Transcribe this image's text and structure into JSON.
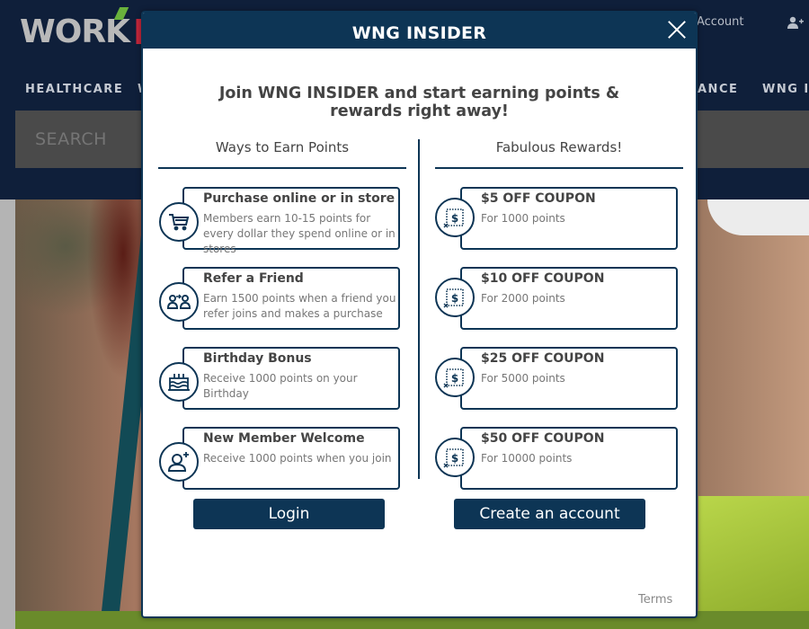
{
  "site": {
    "logo": {
      "work": "WORK",
      "n": "N"
    },
    "account_label": "Account",
    "nav": [
      {
        "label": "HEALTHCARE"
      },
      {
        "label": "W"
      },
      {
        "label": "ANCE"
      },
      {
        "label": "WNG IN"
      }
    ],
    "search": {
      "placeholder": "SEARCH"
    }
  },
  "modal": {
    "title": "WNG INSIDER",
    "headline_line1": "Join WNG INSIDER and start earning points &",
    "headline_line2": "rewards right away!",
    "earn": {
      "title": "Ways to Earn Points",
      "items": [
        {
          "icon": "shopping-cart-icon",
          "title": "Purchase online or in store",
          "desc": "Members earn 10-15 points for every dollar they spend online or in stores"
        },
        {
          "icon": "refer-friend-icon",
          "title": "Refer a Friend",
          "desc": "Earn 1500 points when a friend you refer joins and makes a purchase"
        },
        {
          "icon": "birthday-cake-icon",
          "title": "Birthday Bonus",
          "desc": "Receive 1000 points on your Birthday"
        },
        {
          "icon": "add-user-icon",
          "title": "New Member Welcome",
          "desc": "Receive 1000 points when you join"
        }
      ]
    },
    "rewards": {
      "title": "Fabulous Rewards!",
      "items": [
        {
          "icon": "coupon-icon",
          "title": "$5 OFF COUPON",
          "desc": "For 1000 points"
        },
        {
          "icon": "coupon-icon",
          "title": "$10 OFF COUPON",
          "desc": "For 2000 points"
        },
        {
          "icon": "coupon-icon",
          "title": "$25 OFF COUPON",
          "desc": "For 5000 points"
        },
        {
          "icon": "coupon-icon",
          "title": "$50 OFF COUPON",
          "desc": "For 10000 points"
        }
      ]
    },
    "login_label": "Login",
    "create_account_label": "Create an account",
    "terms_label": "Terms"
  },
  "colors": {
    "brand_navy": "#0d3555",
    "header_bg": "#0f1f3a",
    "logo_red": "#c3263a",
    "logo_green": "#6ab23c"
  }
}
